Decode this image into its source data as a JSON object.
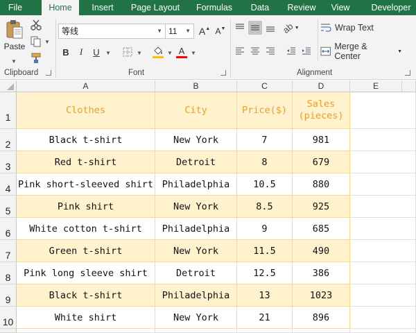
{
  "tabs": [
    "File",
    "Home",
    "Insert",
    "Page Layout",
    "Formulas",
    "Data",
    "Review",
    "View",
    "Developer"
  ],
  "active_tab": "Home",
  "clipboard": {
    "paste_label": "Paste",
    "group_label": "Clipboard"
  },
  "font": {
    "name": "等线",
    "size": "11",
    "group_label": "Font",
    "bold": "B",
    "italic": "I",
    "underline": "U",
    "grow": "A",
    "shrink": "A",
    "font_color": "A"
  },
  "alignment": {
    "wrap_text": "Wrap Text",
    "merge_center": "Merge & Center",
    "group_label": "Alignment"
  },
  "columns": [
    "A",
    "B",
    "C",
    "D",
    "E"
  ],
  "row_numbers": [
    "1",
    "2",
    "3",
    "4",
    "5",
    "6",
    "7",
    "8",
    "9",
    "10"
  ],
  "table": {
    "headers": [
      "Clothes",
      "City",
      "Price($)",
      "Sales (pieces)"
    ],
    "rows": [
      [
        "Black t-shirt",
        "New York",
        "7",
        "981"
      ],
      [
        "Red t-shirt",
        "Detroit",
        "8",
        "679"
      ],
      [
        "Pink short-sleeved shirt",
        "Philadelphia",
        "10.5",
        "880"
      ],
      [
        "Pink shirt",
        "New York",
        "8.5",
        "925"
      ],
      [
        "White cotton t-shirt",
        "Philadelphia",
        "9",
        "685"
      ],
      [
        "Green t-shirt",
        "New York",
        "11.5",
        "490"
      ],
      [
        "Pink long sleeve shirt",
        "Detroit",
        "12.5",
        "386"
      ],
      [
        "Black t-shirt",
        "Philadelphia",
        "13",
        "1023"
      ],
      [
        "White shirt",
        "New York",
        "21",
        "896"
      ]
    ]
  },
  "colors": {
    "accent": "#217346",
    "cell_fill": "#fff2cc",
    "header_text": "#f39b2b",
    "grid_line": "#fcd98c",
    "highlight_underline": "#ffc000",
    "font_color_bar": "#ff0000"
  }
}
